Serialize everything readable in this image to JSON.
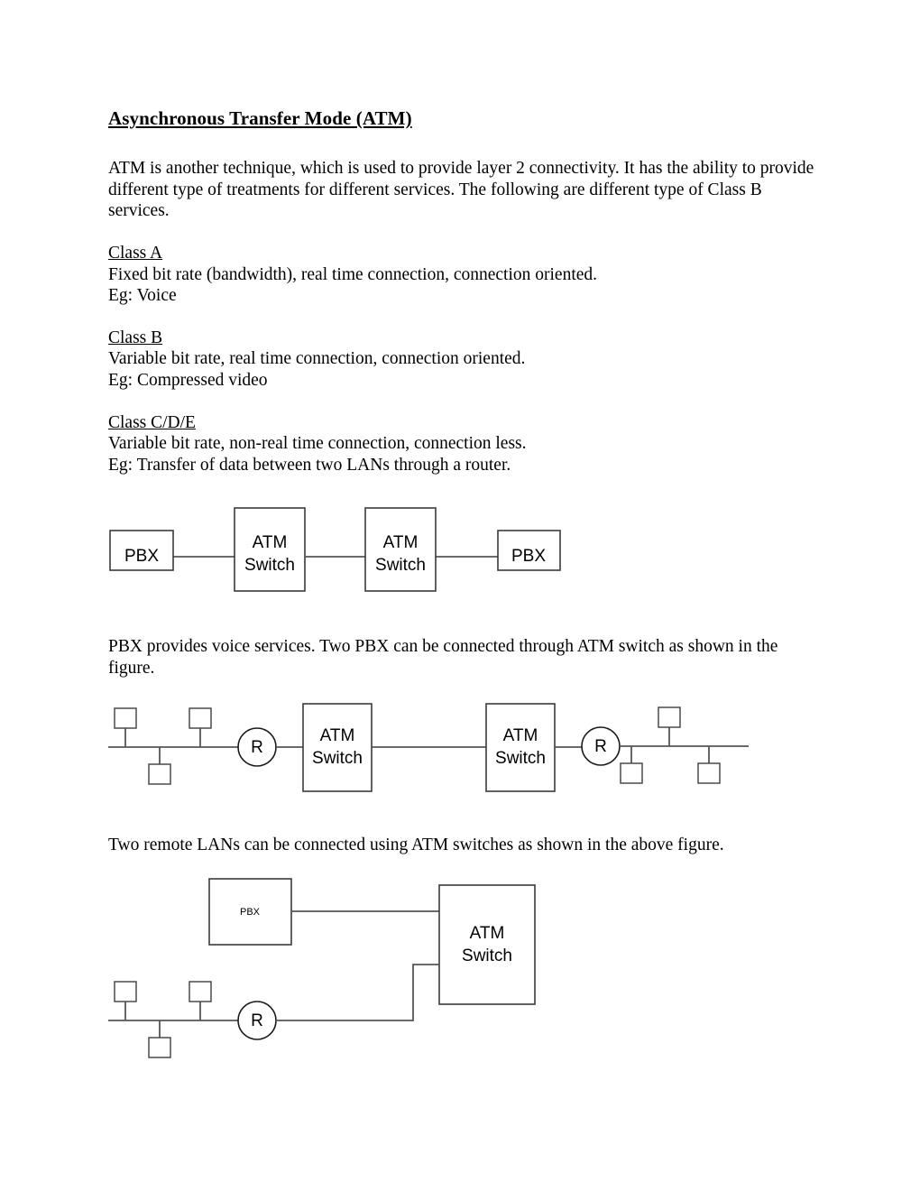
{
  "document": {
    "title": "Asynchronous Transfer Mode (ATM)",
    "intro": "ATM is another technique, which is used to provide layer 2 connectivity. It has the ability to provide different type of treatments for different services. The following are different type of Class B services.",
    "classes": [
      {
        "heading": "Class A",
        "description": "Fixed bit rate (bandwidth), real time connection, connection oriented.",
        "example": "Eg: Voice"
      },
      {
        "heading": "Class B",
        "description": "Variable bit rate, real time connection, connection oriented.",
        "example": "Eg: Compressed video"
      },
      {
        "heading": "Class C/D/E",
        "description": "Variable bit rate, non-real time connection, connection less.",
        "example": "Eg: Transfer of data between two LANs through a router."
      }
    ],
    "caption_figure1": "PBX provides voice services. Two PBX can be connected through ATM switch as shown in the figure.",
    "caption_figure2": "Two remote LANs can be connected using ATM switches as shown in the above figure."
  },
  "figure1": {
    "name": "pbx-to-pbx-over-atm",
    "nodes": {
      "pbx_left": "PBX",
      "switch_left_line1": "ATM",
      "switch_left_line2": "Switch",
      "switch_right_line1": "ATM",
      "switch_right_line2": "Switch",
      "pbx_right": "PBX"
    }
  },
  "figure2": {
    "name": "two-remote-lans-over-atm",
    "nodes": {
      "router_left": "R",
      "switch_left_line1": "ATM",
      "switch_left_line2": "Switch",
      "switch_right_line1": "ATM",
      "switch_right_line2": "Switch",
      "router_right": "R"
    }
  },
  "figure3": {
    "name": "pbx-and-lan-into-single-atm-switch",
    "nodes": {
      "pbx": "PBX",
      "switch_line1": "ATM",
      "switch_line2": "Switch",
      "router": "R"
    }
  },
  "colors": {
    "page_background": "#ffffff",
    "text": "#000000",
    "box_stroke": "#3a3a3a",
    "link_stroke": "#555555"
  }
}
